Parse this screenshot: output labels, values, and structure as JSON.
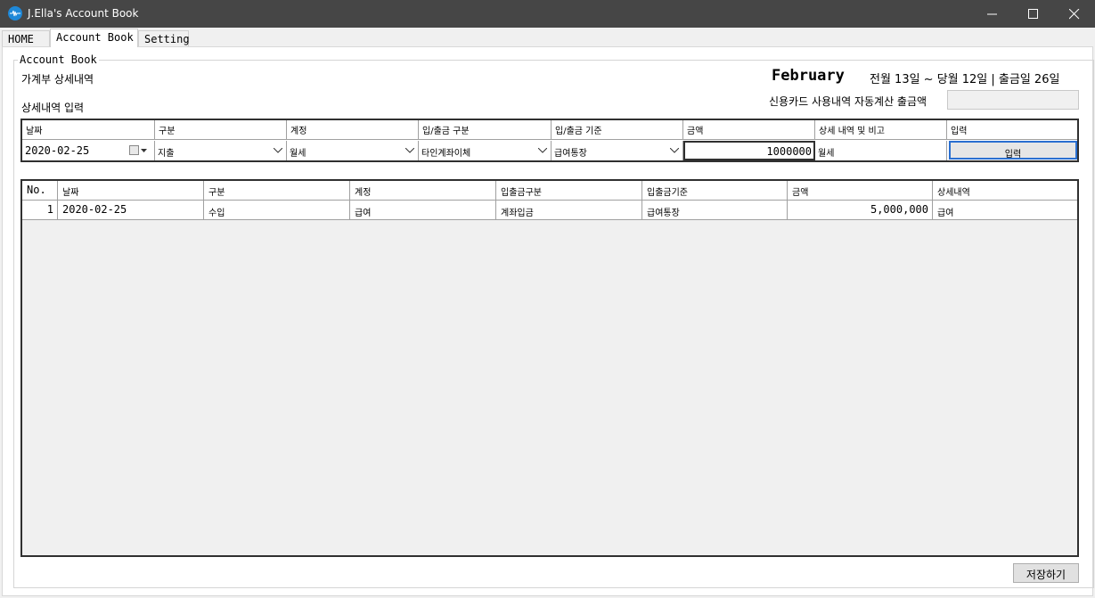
{
  "window": {
    "title": "J.Ella's Account Book",
    "controls": [
      "minimize-icon",
      "maximize-icon",
      "close-icon"
    ]
  },
  "tabs": [
    {
      "label": "HOME",
      "active": false
    },
    {
      "label": "Account Book",
      "active": true
    },
    {
      "label": "Setting",
      "active": false
    }
  ],
  "group": {
    "title": "Account Book",
    "section_title": "가계부 상세내역",
    "input_title": "상세내역 입력"
  },
  "period": {
    "month": "February",
    "range_text": "전월 13일 ~ 당월 12일  |  출금일 26일"
  },
  "card": {
    "label": "신용카드 사용내역 자동계산 출금액",
    "value": ""
  },
  "input_row": {
    "headers": [
      "날짜",
      "구분",
      "계정",
      "입/출금 구분",
      "입/출금 기준",
      "금액",
      "상세 내역 및 비고",
      "입력"
    ],
    "date": "2020-02-25",
    "type": "지출",
    "account": "월세",
    "method": "타인계좌이체",
    "source": "급여통장",
    "amount": "1000000",
    "memo": "월세",
    "enter_label": "입력"
  },
  "table": {
    "headers": [
      "No.",
      "날짜",
      "구분",
      "계정",
      "입출금구분",
      "입출금기준",
      "금액",
      "상세내역"
    ],
    "rows": [
      {
        "no": "1",
        "date": "2020-02-25",
        "type": "수입",
        "account": "급여",
        "method": "계좌입금",
        "source": "급여통장",
        "amount": "5,000,000",
        "memo": "급여"
      }
    ]
  },
  "save_label": "저장하기",
  "colors": {
    "titlebar": "#464646",
    "accent": "#1e88d8",
    "focus_border": "#2a6fd0"
  }
}
